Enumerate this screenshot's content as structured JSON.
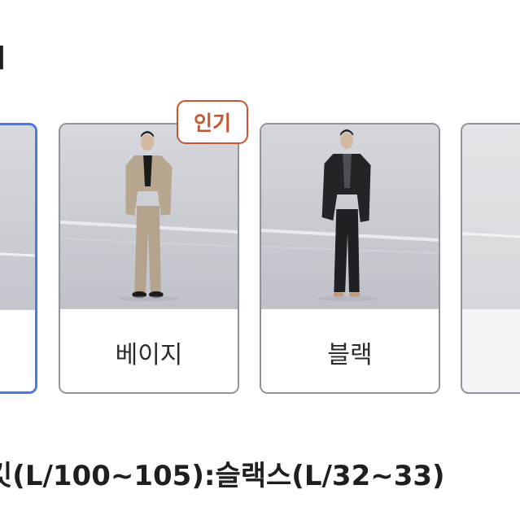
{
  "section": {
    "title": "l"
  },
  "options": [
    {
      "label": "",
      "selected": true,
      "badge": ""
    },
    {
      "label": "베이지",
      "selected": false,
      "badge": "인기"
    },
    {
      "label": "블랙",
      "selected": false,
      "badge": ""
    },
    {
      "label": "",
      "selected": false,
      "badge": ""
    }
  ],
  "spec": {
    "text": "킷(L/100~105):슬랙스(L/32~33)"
  },
  "colors": {
    "selected_border": "#4a78e8",
    "card_border": "#8f949b",
    "badge": "#c8552f",
    "beige_suit": "#b8a690",
    "black_suit": "#232428"
  },
  "icons": {
    "model_photo": "suit-model-photo"
  }
}
